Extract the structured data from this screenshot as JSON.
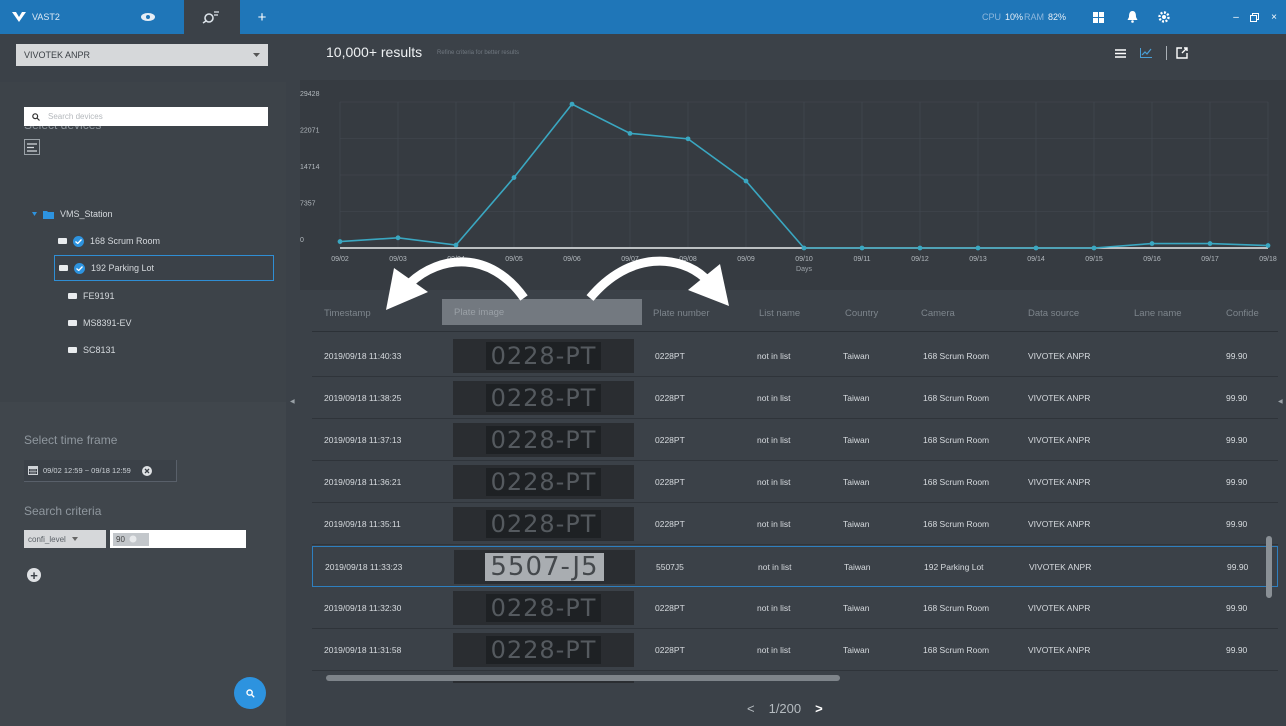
{
  "app": {
    "name": "VAST2",
    "cpu_label": "CPU",
    "cpu": "10%",
    "ram_label": "RAM",
    "ram": "82%"
  },
  "sidebar": {
    "source": "VIVOTEK ANPR",
    "select_devices_title": "Select devices",
    "device_search_placeholder": "Search devices",
    "tree": [
      {
        "label": "VMS_Station",
        "type": "station",
        "checked": false,
        "selected": false
      },
      {
        "label": "168 Scrum Room",
        "type": "camera",
        "checked": true,
        "selected": false
      },
      {
        "label": "192 Parking Lot",
        "type": "camera",
        "checked": true,
        "selected": true
      },
      {
        "label": "FE9191",
        "type": "camera",
        "checked": false,
        "selected": false
      },
      {
        "label": "MS8391-EV",
        "type": "camera",
        "checked": false,
        "selected": false
      },
      {
        "label": "SC8131",
        "type": "camera",
        "checked": false,
        "selected": false
      }
    ],
    "time_title": "Select time frame",
    "time_range": "09/02 12:59 ~ 09/18 12:59",
    "criteria_title": "Search criteria",
    "criteria_field": "confi_level",
    "criteria_value": "90"
  },
  "results": {
    "count": "10,000+ results",
    "hint": "Refine criteria for better results"
  },
  "chart_data": {
    "type": "line",
    "xlabel": "Days",
    "ylabel": "",
    "categories": [
      "09/02",
      "09/03",
      "09/04",
      "09/05",
      "09/06",
      "09/07",
      "09/08",
      "09/09",
      "09/10",
      "09/11",
      "09/12",
      "09/13",
      "09/14",
      "09/15",
      "09/16",
      "09/17",
      "09/18"
    ],
    "yticks": [
      0,
      7357,
      14714,
      22071,
      29428
    ],
    "ylim": [
      0,
      29428
    ],
    "values": [
      1300,
      2050,
      600,
      14200,
      29000,
      23100,
      22000,
      13500,
      0,
      0,
      0,
      0,
      0,
      0,
      900,
      900,
      500
    ],
    "color": "#3aa7c1",
    "grid": true
  },
  "table": {
    "columns": [
      "Timestamp",
      "Plate image",
      "Plate number",
      "List name",
      "Country",
      "Camera",
      "Data source",
      "Lane name",
      "Confide"
    ],
    "rows": [
      {
        "timestamp": "2019/09/18 11:40:33",
        "plate_image": "0228-PT",
        "plate_number": "0228PT",
        "list_name": "not in list",
        "country": "Taiwan",
        "camera": "168 Scrum Room",
        "data_source": "VIVOTEK ANPR",
        "lane_name": "",
        "confidence": "99.90"
      },
      {
        "timestamp": "2019/09/18 11:38:25",
        "plate_image": "0228-PT",
        "plate_number": "0228PT",
        "list_name": "not in list",
        "country": "Taiwan",
        "camera": "168 Scrum Room",
        "data_source": "VIVOTEK ANPR",
        "lane_name": "",
        "confidence": "99.90"
      },
      {
        "timestamp": "2019/09/18 11:37:13",
        "plate_image": "0228-PT",
        "plate_number": "0228PT",
        "list_name": "not in list",
        "country": "Taiwan",
        "camera": "168 Scrum Room",
        "data_source": "VIVOTEK ANPR",
        "lane_name": "",
        "confidence": "99.90"
      },
      {
        "timestamp": "2019/09/18 11:36:21",
        "plate_image": "0228-PT",
        "plate_number": "0228PT",
        "list_name": "not in list",
        "country": "Taiwan",
        "camera": "168 Scrum Room",
        "data_source": "VIVOTEK ANPR",
        "lane_name": "",
        "confidence": "99.90"
      },
      {
        "timestamp": "2019/09/18 11:35:11",
        "plate_image": "0228-PT",
        "plate_number": "0228PT",
        "list_name": "not in list",
        "country": "Taiwan",
        "camera": "168 Scrum Room",
        "data_source": "VIVOTEK ANPR",
        "lane_name": "",
        "confidence": "99.90"
      },
      {
        "timestamp": "2019/09/18 11:33:23",
        "plate_image": "5507-J5",
        "plate_number": "5507J5",
        "list_name": "not in list",
        "country": "Taiwan",
        "camera": "192 Parking Lot",
        "data_source": "VIVOTEK ANPR",
        "lane_name": "",
        "confidence": "99.90"
      },
      {
        "timestamp": "2019/09/18 11:32:30",
        "plate_image": "0228-PT",
        "plate_number": "0228PT",
        "list_name": "not in list",
        "country": "Taiwan",
        "camera": "168 Scrum Room",
        "data_source": "VIVOTEK ANPR",
        "lane_name": "",
        "confidence": "99.90"
      },
      {
        "timestamp": "2019/09/18 11:31:58",
        "plate_image": "0228-PT",
        "plate_number": "0228PT",
        "list_name": "not in list",
        "country": "Taiwan",
        "camera": "168 Scrum Room",
        "data_source": "VIVOTEK ANPR",
        "lane_name": "",
        "confidence": "99.90"
      }
    ],
    "selected_row": 5
  },
  "pager": {
    "prev": "<",
    "label": "1/200",
    "next": ">"
  }
}
